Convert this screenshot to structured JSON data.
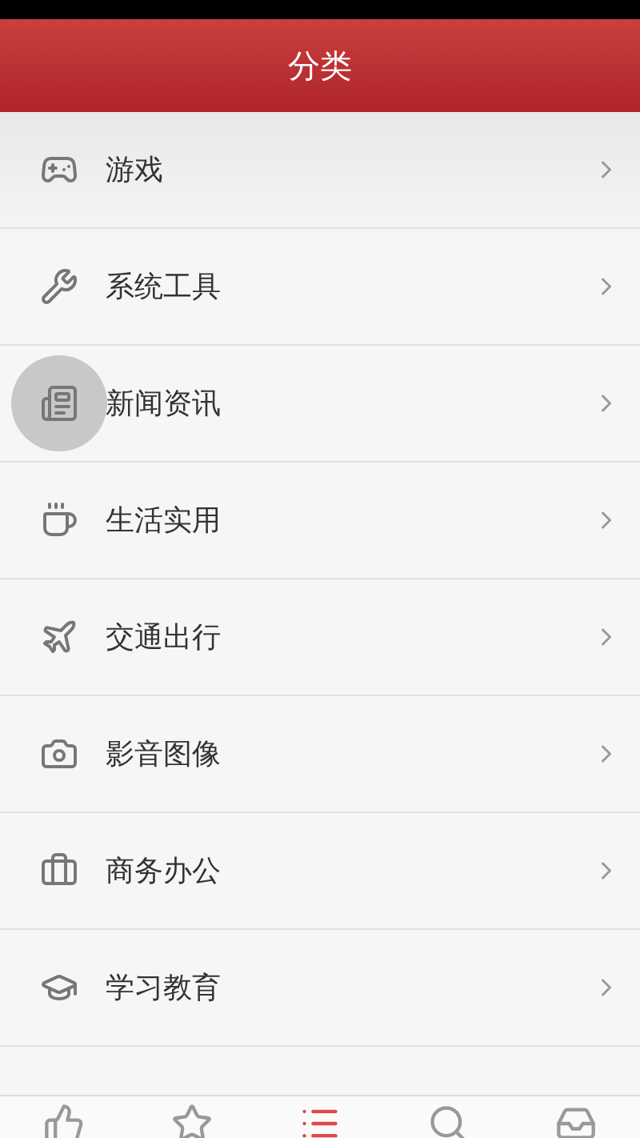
{
  "header": {
    "title": "分类"
  },
  "categories": [
    {
      "label": "游戏",
      "pressed": false
    },
    {
      "label": "系统工具",
      "pressed": false
    },
    {
      "label": "新闻资讯",
      "pressed": true
    },
    {
      "label": "生活实用",
      "pressed": false
    },
    {
      "label": "交通出行",
      "pressed": false
    },
    {
      "label": "影音图像",
      "pressed": false
    },
    {
      "label": "商务办公",
      "pressed": false
    },
    {
      "label": "学习教育",
      "pressed": false
    }
  ],
  "tabs": [
    {
      "selected": false
    },
    {
      "selected": false
    },
    {
      "selected": true
    },
    {
      "selected": false
    },
    {
      "selected": false
    }
  ]
}
